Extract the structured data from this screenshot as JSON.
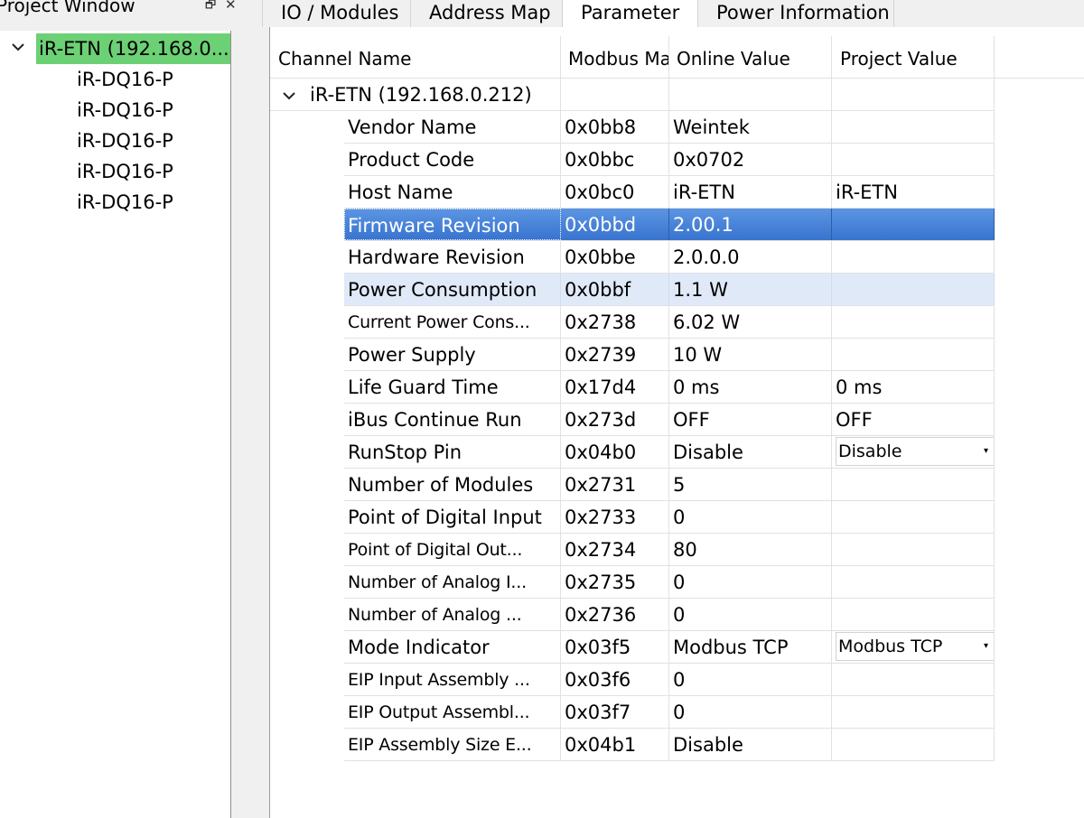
{
  "project_window": {
    "title": "Project Window",
    "float_icon": "float-icon",
    "close_icon": "close-icon",
    "root": {
      "label": "iR-ETN (192.168.0...",
      "expanded": true
    },
    "children": [
      "iR-DQ16-P",
      "iR-DQ16-P",
      "iR-DQ16-P",
      "iR-DQ16-P",
      "iR-DQ16-P"
    ]
  },
  "tabs": [
    {
      "label": "IO / Modules",
      "active": false
    },
    {
      "label": "Address Map",
      "active": false
    },
    {
      "label": "Parameter",
      "active": true
    },
    {
      "label": "Power Information",
      "active": false
    }
  ],
  "grid": {
    "columns": [
      "Channel Name",
      "Modbus Ma",
      "Online Value",
      "Project Value"
    ],
    "root_row": {
      "label": "iR-ETN (192.168.0.212)"
    },
    "rows": [
      {
        "name": "Vendor Name",
        "addr": "0x0bb8",
        "online": "Weintek",
        "project": ""
      },
      {
        "name": "Product Code",
        "addr": "0x0bbc",
        "online": "0x0702",
        "project": ""
      },
      {
        "name": "Host Name",
        "addr": "0x0bc0",
        "online": "iR-ETN",
        "project": "iR-ETN"
      },
      {
        "name": "Firmware Revision",
        "addr": "0x0bbd",
        "online": "2.00.1",
        "project": ""
      },
      {
        "name": "Hardware Revision",
        "addr": "0x0bbe",
        "online": "2.0.0.0",
        "project": ""
      },
      {
        "name": "Power Consumption",
        "addr": "0x0bbf",
        "online": "1.1 W",
        "project": ""
      },
      {
        "name": "Current Power Cons...",
        "addr": "0x2738",
        "online": "6.02 W",
        "project": ""
      },
      {
        "name": "Power Supply",
        "addr": "0x2739",
        "online": "10 W",
        "project": ""
      },
      {
        "name": "Life Guard Time",
        "addr": "0x17d4",
        "online": "0 ms",
        "project": "0 ms"
      },
      {
        "name": "iBus Continue Run",
        "addr": "0x273d",
        "online": "OFF",
        "project": "OFF"
      },
      {
        "name": "RunStop Pin",
        "addr": "0x04b0",
        "online": "Disable",
        "project": "Disable"
      },
      {
        "name": "Number of Modules",
        "addr": "0x2731",
        "online": "5",
        "project": ""
      },
      {
        "name": "Point of Digital Input",
        "addr": "0x2733",
        "online": "0",
        "project": ""
      },
      {
        "name": "Point of Digital Out...",
        "addr": "0x2734",
        "online": "80",
        "project": ""
      },
      {
        "name": "Number of Analog I...",
        "addr": "0x2735",
        "online": "0",
        "project": ""
      },
      {
        "name": "Number of Analog ...",
        "addr": "0x2736",
        "online": "0",
        "project": ""
      },
      {
        "name": "Mode Indicator",
        "addr": "0x03f5",
        "online": "Modbus TCP",
        "project": "Modbus TCP"
      },
      {
        "name": "EIP Input Assembly ...",
        "addr": "0x03f6",
        "online": "0",
        "project": ""
      },
      {
        "name": "EIP Output Assembl...",
        "addr": "0x03f7",
        "online": "0",
        "project": ""
      },
      {
        "name": "EIP Assembly Size E...",
        "addr": "0x04b1",
        "online": "Disable",
        "project": ""
      }
    ],
    "selected_row": "Firmware Revision",
    "hover_row": "Power Consumption"
  },
  "colors": {
    "root_highlight": "#6cd075",
    "selection": "#3874cf",
    "hover": "#dfe9f8"
  }
}
